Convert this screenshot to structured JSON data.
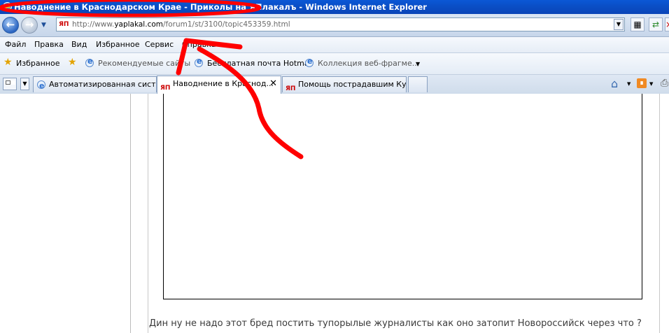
{
  "window": {
    "title": "Наводнение в Краснодарском Крае - Приколы на ЯПлакалъ - Windows Internet Explorer"
  },
  "address": {
    "favicon": "ЯП",
    "url_prefix": "http://www.",
    "url_domain": "yaplakal.com",
    "url_path": "/forum1/st/3100/topic453359.html"
  },
  "menu": [
    "Файл",
    "Правка",
    "Вид",
    "Избранное",
    "Сервис",
    "Справка"
  ],
  "favorites": {
    "label": "Избранное",
    "items": [
      "Рекомендуемые сайты",
      "Бесплатная почта Hotmail",
      "Коллекция веб-фрагме..."
    ]
  },
  "tabs": [
    {
      "label": "Автоматизированная сист..."
    },
    {
      "label": "Наводнение в Краснод...",
      "active": true
    },
    {
      "label": "Помощь пострадавшим Ку..."
    }
  ],
  "post": {
    "comment": "Дин ну не надо этот бред постить тупорылые журналисты как оно затопит Новороссийск через что ?"
  },
  "colors": {
    "titlebar": "#0a4fc7",
    "annotation": "#ff0000"
  },
  "icons": [
    "back-icon",
    "forward-icon",
    "star-icon",
    "home-icon",
    "rss-icon",
    "print-icon",
    "close-icon"
  ]
}
